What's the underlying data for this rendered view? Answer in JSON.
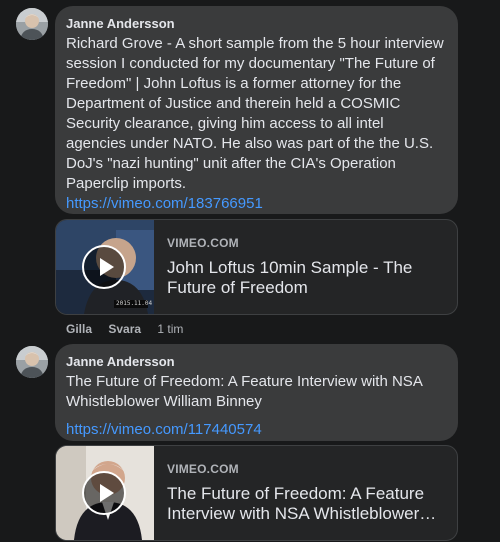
{
  "comments": [
    {
      "author": "Janne Andersson",
      "text": "Richard Grove - A short sample from the 5 hour interview session I conducted for my documentary \"The Future of Freedom\" | John Loftus is a former attorney for the Department of Justice and therein held a COSMIC Security clearance, giving him access to all intel agencies under NATO. He also was part of the the U.S. DoJ's \"nazi hunting\" unit after the CIA's Operation Paperclip imports.",
      "link": "https://vimeo.com/183766951",
      "card": {
        "domain": "VIMEO.COM",
        "title": "John Loftus 10min Sample - The Future of Freedom",
        "thumb_caption": "2015.11.04"
      },
      "actions": {
        "like": "Gilla",
        "reply": "Svara",
        "time": "1 tim"
      }
    },
    {
      "author": "Janne Andersson",
      "text": "The Future of Freedom: A Feature Interview with NSA Whistleblower William Binney",
      "link": "https://vimeo.com/117440574",
      "card": {
        "domain": "VIMEO.COM",
        "title": "The Future of Freedom: A Feature Interview with NSA Whistleblower William Binney"
      }
    }
  ]
}
